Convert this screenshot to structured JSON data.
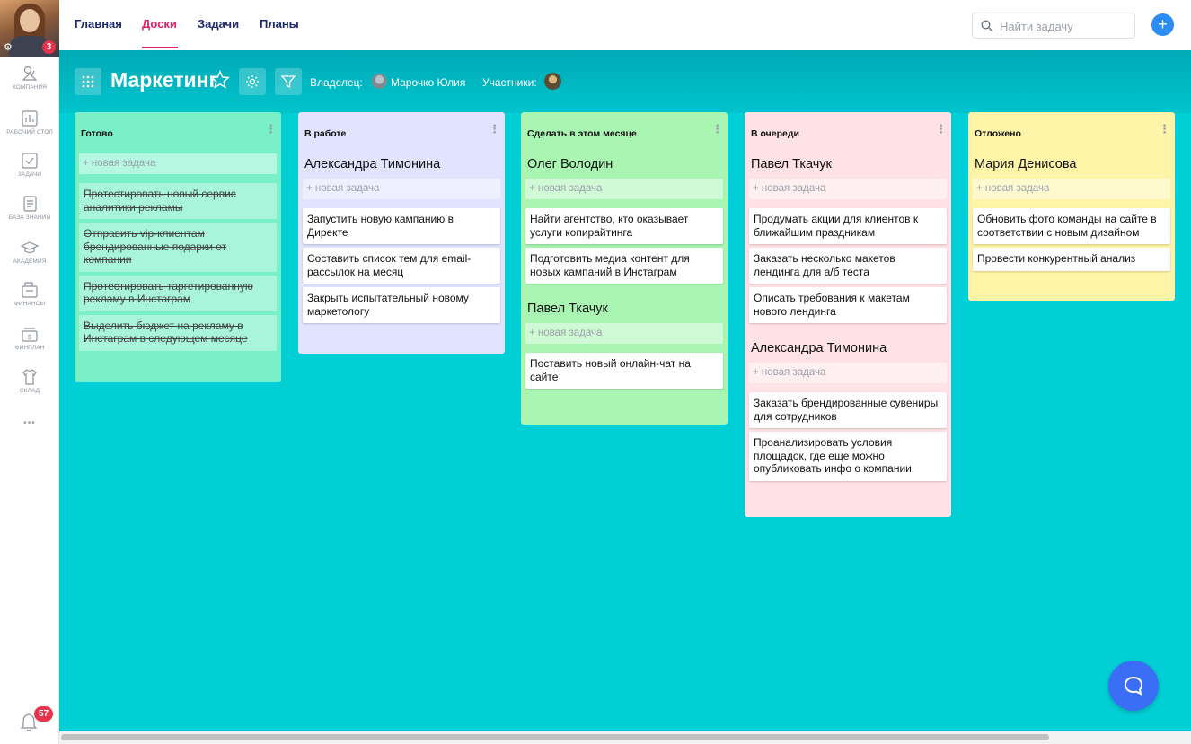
{
  "sidebar": {
    "avatar_badge": "3",
    "items": [
      {
        "label": "Компания",
        "icon": "company-icon"
      },
      {
        "label": "Рабочий стол",
        "icon": "dashboard-icon"
      },
      {
        "label": "Задачи",
        "icon": "tasks-checkbox-icon"
      },
      {
        "label": "База знаний",
        "icon": "knowledge-base-icon"
      },
      {
        "label": "Академия",
        "icon": "graduation-cap-icon"
      },
      {
        "label": "Финансы",
        "icon": "wallet-icon"
      },
      {
        "label": "Финплан",
        "icon": "cash-register-icon"
      },
      {
        "label": "Склад",
        "icon": "tshirt-icon"
      }
    ],
    "more": "•••",
    "notifications_count": "57"
  },
  "topbar": {
    "tabs": [
      "Главная",
      "Доски",
      "Задачи",
      "Планы"
    ],
    "active_tab": "Доски",
    "search_placeholder": "Найти задачу",
    "add_label": "+"
  },
  "board": {
    "title": "Маркетинг",
    "owner_label": "Владелец:",
    "owner_name": "Марочко Юлия",
    "members_label": "Участники:"
  },
  "new_task_label": "+ новая задача",
  "columns": [
    {
      "title": "Готово",
      "color": "#7af0c8",
      "groups": [
        {
          "name": "",
          "tasks": [
            "Протестировать новый сервис аналитики рекламы",
            "Отправить vip-клиентам брендированные подарки от компании",
            "Протестировать таргетированную рекламу в Инстаграм",
            "Выделить бюджет на рекламу в Инстаграм в следующем месяце"
          ],
          "done": true
        }
      ]
    },
    {
      "title": "В работе",
      "color": "#e1e3ff",
      "groups": [
        {
          "name": "Александра Тимонина",
          "tasks": [
            "Запустить новую кампанию в Директе",
            "Составить список тем для email-рассылок на месяц",
            "Закрыть испытательный новому маркетологу"
          ]
        }
      ]
    },
    {
      "title": "Сделать в этом месяце",
      "color": "#a9f5b2",
      "groups": [
        {
          "name": "Олег Володин",
          "tasks": [
            "Найти агентство, кто оказывает услуги копирайтинга",
            "Подготовить медиа контент для новых кампаний в Инстаграм"
          ]
        },
        {
          "name": "Павел Ткачук",
          "tasks": [
            "Поставить новый онлайн-чат на сайте"
          ]
        }
      ]
    },
    {
      "title": "В очереди",
      "color": "#ffe2e6",
      "groups": [
        {
          "name": "Павел Ткачук",
          "tasks": [
            "Продумать акции для клиентов к ближайшим праздникам",
            "Заказать несколько макетов лендинга для а/б теста",
            "Описать требования к макетам нового лендинга"
          ]
        },
        {
          "name": "Александра Тимонина",
          "tasks": [
            "Заказать брендированные сувениры для сотрудников",
            "Проанализировать условия площадок, где еще можно опубликовать инфо о компании"
          ]
        }
      ]
    },
    {
      "title": "Отложено",
      "color": "#fff4a8",
      "groups": [
        {
          "name": "Мария Денисова",
          "tasks": [
            "Обновить фото команды на сайте в соответствии с новым дизайном",
            "Провести конкурентный анализ"
          ]
        }
      ]
    }
  ]
}
